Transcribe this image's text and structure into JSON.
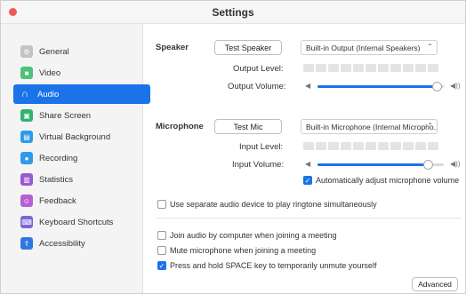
{
  "window": {
    "title": "Settings"
  },
  "sidebar": {
    "items": [
      {
        "label": "General",
        "icon": "gear-icon",
        "color": "#b9b9b9",
        "active": false
      },
      {
        "label": "Video",
        "icon": "video-icon",
        "color": "#4cc27a",
        "active": false
      },
      {
        "label": "Audio",
        "icon": "headphones-icon",
        "color": "#1a73e8",
        "active": true
      },
      {
        "label": "Share Screen",
        "icon": "share-screen-icon",
        "color": "#2fb36f",
        "active": false
      },
      {
        "label": "Virtual Background",
        "icon": "virtual-background-icon",
        "color": "#2e9be8",
        "active": false
      },
      {
        "label": "Recording",
        "icon": "recording-icon",
        "color": "#2e9be8",
        "active": false
      },
      {
        "label": "Statistics",
        "icon": "statistics-icon",
        "color": "#9b59d0",
        "active": false
      },
      {
        "label": "Feedback",
        "icon": "feedback-icon",
        "color": "#b65fd6",
        "active": false
      },
      {
        "label": "Keyboard Shortcuts",
        "icon": "keyboard-icon",
        "color": "#7a66d8",
        "active": false
      },
      {
        "label": "Accessibility",
        "icon": "accessibility-icon",
        "color": "#2f78e0",
        "active": false
      }
    ]
  },
  "speaker": {
    "section_label": "Speaker",
    "test_button": "Test Speaker",
    "device": "Built-in Output (Internal Speakers)",
    "output_level_label": "Output Level:",
    "output_volume_label": "Output Volume:",
    "volume_fraction": 0.95
  },
  "microphone": {
    "section_label": "Microphone",
    "test_button": "Test Mic",
    "device": "Built-in Microphone (Internal Micropho...",
    "input_level_label": "Input Level:",
    "input_volume_label": "Input Volume:",
    "volume_fraction": 0.88,
    "auto_adjust_label": "Automatically adjust microphone volume",
    "auto_adjust_checked": true
  },
  "options": {
    "separate_device": {
      "label": "Use separate audio device to play ringtone simultaneously",
      "checked": false
    },
    "join_audio": {
      "label": "Join audio by computer when joining a meeting",
      "checked": false
    },
    "mute_mic": {
      "label": "Mute microphone when joining a meeting",
      "checked": false
    },
    "space_unmute": {
      "label": "Press and hold SPACE key to temporarily unmute yourself",
      "checked": true
    }
  },
  "advanced_button": "Advanced",
  "accent_color": "#1a73e8"
}
